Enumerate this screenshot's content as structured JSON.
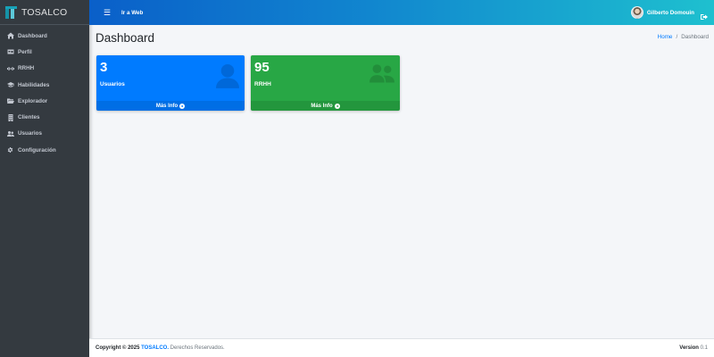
{
  "brand": {
    "name": "TOSALCO"
  },
  "sidebar": {
    "items": [
      {
        "label": "Dashboard",
        "icon": "home-icon"
      },
      {
        "label": "Perfil",
        "icon": "id-card-icon"
      },
      {
        "label": "RRHH",
        "icon": "users-cog-icon"
      },
      {
        "label": "Habilidades",
        "icon": "graduation-cap-icon"
      },
      {
        "label": "Explorador",
        "icon": "folder-open-icon"
      },
      {
        "label": "Clientes",
        "icon": "building-icon"
      },
      {
        "label": "Usuarios",
        "icon": "users-icon"
      },
      {
        "label": "Configuración",
        "icon": "cogs-icon"
      }
    ]
  },
  "topbar": {
    "menu_icon": "bars-icon",
    "web_link": "Ir a Web",
    "user_name": "Gilberto Domouin",
    "logout_icon": "sign-out-icon"
  },
  "header": {
    "title": "Dashboard",
    "breadcrumb": {
      "home": "Home",
      "separator": "/",
      "current": "Dashboard"
    }
  },
  "boxes": [
    {
      "value": "3",
      "label": "Usuarios",
      "footer": "Más Info",
      "icon": "user-icon",
      "color": "#007bff"
    },
    {
      "value": "95",
      "label": "RRHH",
      "footer": "Más Info",
      "icon": "users-icon",
      "color": "#28a745"
    }
  ],
  "footer": {
    "copyright": "Copyright © 2025",
    "brand": "TOSALCO.",
    "rights": "Derechos Reservados.",
    "version_label": "Version",
    "version": "0.1"
  },
  "colors": {
    "sidebar_bg": "#343a40",
    "topbar_start": "#0a5fc9",
    "topbar_end": "#1ec0cf",
    "content_bg": "#f4f6f9",
    "link": "#007bff"
  }
}
